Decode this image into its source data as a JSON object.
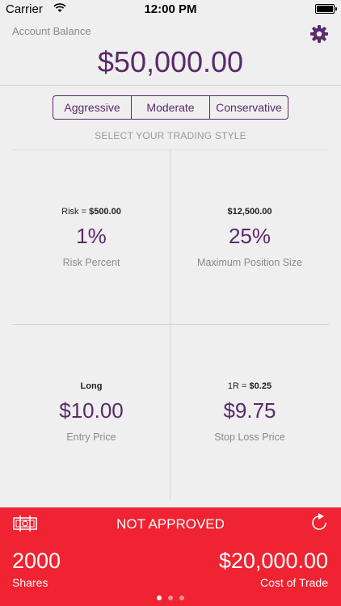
{
  "status_bar": {
    "carrier": "Carrier",
    "time": "12:00 PM"
  },
  "header": {
    "account_label": "Account Balance",
    "balance": "$50,000.00"
  },
  "trading_style": {
    "options": [
      "Aggressive",
      "Moderate",
      "Conservative"
    ],
    "prompt": "SELECT YOUR TRADING STYLE"
  },
  "cells": {
    "risk": {
      "caption_prefix": "Risk = ",
      "caption_value": "$500.00",
      "value": "1%",
      "label": "Risk Percent"
    },
    "position": {
      "caption_value": "$12,500.00",
      "value": "25%",
      "label": "Maximum Position Size"
    },
    "entry": {
      "caption_value": "Long",
      "value": "$10.00",
      "label": "Entry Price"
    },
    "stop": {
      "caption_prefix": "1R = ",
      "caption_value": "$0.25",
      "value": "$9.75",
      "label": "Stop Loss Price"
    }
  },
  "footer": {
    "status": "NOT APPROVED",
    "shares_value": "2000",
    "shares_label": "Shares",
    "cost_value": "$20,000.00",
    "cost_label": "Cost of Trade",
    "page_count": 3,
    "active_page": 1
  },
  "colors": {
    "accent": "#5b2a6a",
    "alert": "#ef2332",
    "background": "#efefef"
  },
  "icons": [
    "wifi-icon",
    "battery-icon",
    "gear-icon",
    "money-icon",
    "refresh-icon"
  ]
}
